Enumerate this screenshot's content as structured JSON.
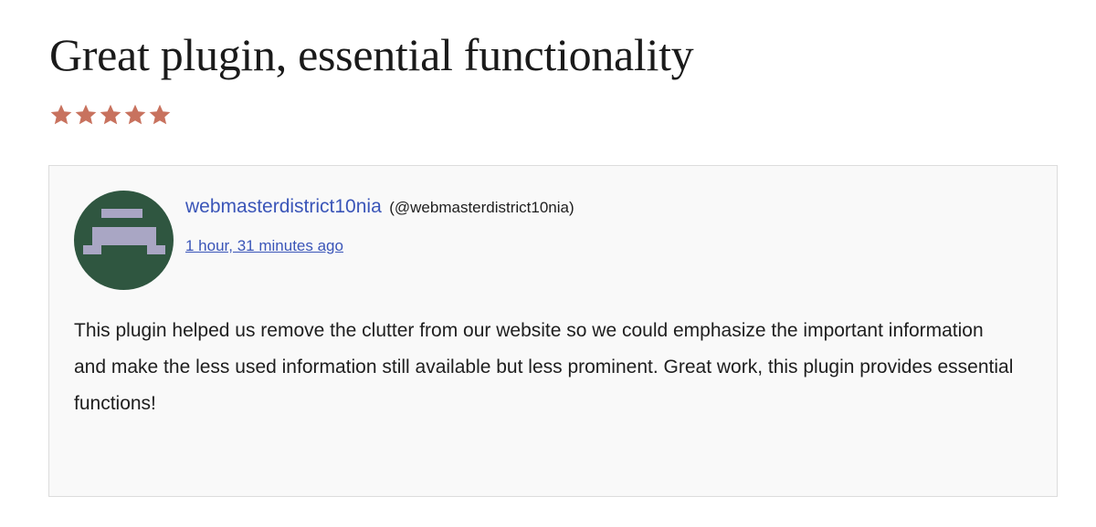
{
  "review": {
    "title": "Great plugin, essential functionality",
    "rating": 5,
    "rating_max": 5,
    "star_color": "#c8725e",
    "author": {
      "name": "webmasterdistrict10nia",
      "handle": "(@webmasterdistrict10nia)",
      "avatar_icon": "pixel-identicon",
      "avatar_bg": "#2f5640",
      "avatar_fg": "#a9a6c4"
    },
    "timestamp": "1 hour, 31 minutes ago",
    "body": "This plugin helped us remove the clutter from our website so we could emphasize the important information and make the less used information still available but less prominent. Great work, this plugin provides essential functions!"
  },
  "colors": {
    "link": "#3a55b8",
    "card_bg": "#f9f9f9",
    "card_border": "#dcdcdc"
  }
}
